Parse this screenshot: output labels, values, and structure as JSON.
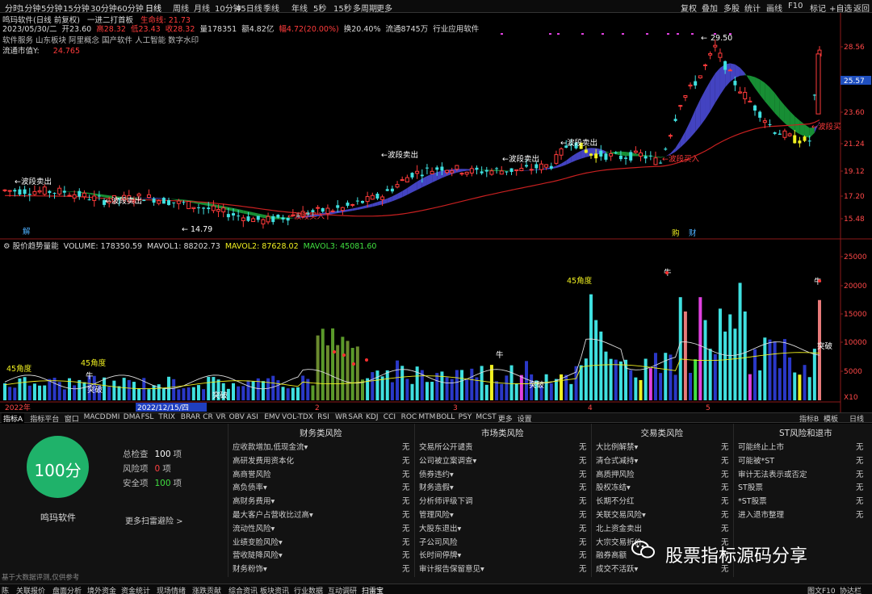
{
  "timeframes": [
    "分时",
    "1分钟",
    "5分钟",
    "15分钟",
    "30分钟",
    "60分钟",
    "日线",
    "周线",
    "月线",
    "10分钟",
    "45日线",
    "季线",
    "年线",
    "5秒",
    "15秒",
    "多周期",
    "更多"
  ],
  "active_timeframe": "日线",
  "right_toolbar": [
    "复权",
    "叠加",
    "多股",
    "统计",
    "画线",
    "F10",
    "标记",
    "+自选",
    "返回"
  ],
  "stock": {
    "title": "鸣玛软件(日线 前复权)",
    "indicator_name": "一进二打首板",
    "life_line_label": "生命线: 21.73",
    "date": "2023/05/30/二",
    "open": "开23.60",
    "high": "高28.32",
    "low": "低23.43",
    "close": "收28.32",
    "volume": "量178351",
    "amount": "额4.82亿",
    "change": "幅4.72(20.00%)",
    "turnover": "换20.40%",
    "float_shares": "流通8745万",
    "industry": "行业应用软件",
    "concepts": "软件服务 山东板块 阿里概念 国产软件 人工智能 数字水印",
    "float_mv_label": "流通市值Y:",
    "float_mv_value": "24.765"
  },
  "price_axis": [
    "28.56",
    "25.57",
    "23.60",
    "21.24",
    "19.12",
    "17.20",
    "15.48"
  ],
  "price_axis_highlight": "25.57",
  "price_annotations": {
    "high_label": "29.50",
    "low_label": "14.79",
    "band_sell_1": "波段卖出",
    "band_sell_2": "波段卖出",
    "band_sell_3": "波段卖出",
    "band_sell_4": "波段卖出",
    "band_sell_5": "波段卖出",
    "band_buy_1": "波段买入",
    "band_buy_2": "波段买入",
    "band_buy_3": "波段买",
    "marker_jie": "解",
    "marker_gou": "购",
    "marker_cai": "财"
  },
  "volume_header": {
    "name": "股价趋势量能",
    "volume": "VOLUME: 178350.59",
    "mavol1": "MAVOL1: 88202.73",
    "mavol2": "MAVOL2: 87628.02",
    "mavol3": "MAVOL3: 45081.60"
  },
  "volume_axis": [
    "25000",
    "20000",
    "15000",
    "10000",
    "5000"
  ],
  "volume_scale_label": "X10",
  "volume_annotations": {
    "angle_1": "45角度",
    "angle_2": "45角度",
    "angle_3": "45角度",
    "niu": "牛",
    "breakthrough": "突破"
  },
  "date_axis": {
    "year": "2022年",
    "cursor_date": "2022/12/15/四",
    "marks": [
      "2",
      "3",
      "4",
      "5"
    ]
  },
  "indicator_tabs": [
    "指标A",
    "指标平台",
    "窗口",
    "MACD",
    "DMI",
    "DMA",
    "FSL",
    "TRIX",
    "BRAR",
    "CR",
    "VR",
    "OBV",
    "ASI",
    "EMV",
    "VOL-TDX",
    "RSI",
    "WR",
    "SAR",
    "KDJ",
    "CCI",
    "ROC",
    "MTM",
    "BOLL",
    "PSY",
    "MCST",
    "更多",
    "设置"
  ],
  "indicator_tabs_right": [
    "指标B",
    "模板",
    "日线"
  ],
  "risk": {
    "score": "100分",
    "stock_name": "鸣玛软件",
    "total_label": "总检查",
    "total_value": "100",
    "total_unit": "项",
    "risk_label": "风险项",
    "risk_value": "0",
    "risk_unit": "项",
    "safe_label": "安全项",
    "safe_value": "100",
    "safe_unit": "项",
    "more_link": "更多扫雷避险 >",
    "disclaimer": "基于大数据评测,仅供参考",
    "columns": [
      {
        "title": "财务类风险",
        "rows": [
          [
            "应收款增加,低现金流▾",
            "无"
          ],
          [
            "高研发费用资本化",
            "无"
          ],
          [
            "高商誉风险",
            "无"
          ],
          [
            "高负债率▾",
            "无"
          ],
          [
            "高财务费用▾",
            "无"
          ],
          [
            "最大客户占营收比过高▾",
            "无"
          ],
          [
            "流动性风险▾",
            "无"
          ],
          [
            "业绩变脸风险▾",
            "无"
          ],
          [
            "营收陡降风险▾",
            "无"
          ],
          [
            "财务粉饰▾",
            "无"
          ]
        ]
      },
      {
        "title": "市场类风险",
        "rows": [
          [
            "交易所公开谴责",
            "无"
          ],
          [
            "公司被立案调查▾",
            "无"
          ],
          [
            "债券违约▾",
            "无"
          ],
          [
            "财务造假▾",
            "无"
          ],
          [
            "分析师评级下调",
            "无"
          ],
          [
            "管理风险▾",
            "无"
          ],
          [
            "大股东退出▾",
            "无"
          ],
          [
            "子公司风险",
            "无"
          ],
          [
            "长时间停牌▾",
            "无"
          ],
          [
            "审计报告保留意见▾",
            "无"
          ]
        ]
      },
      {
        "title": "交易类风险",
        "rows": [
          [
            "大比例解禁▾",
            "无"
          ],
          [
            "清仓式减持▾",
            "无"
          ],
          [
            "高质押风险",
            "无"
          ],
          [
            "股权冻结▾",
            "无"
          ],
          [
            "长期不分红",
            "无"
          ],
          [
            "关联交易风险▾",
            "无"
          ],
          [
            "北上资金卖出",
            "无"
          ],
          [
            "大宗交易折价",
            "无"
          ],
          [
            "融券高额",
            "无"
          ],
          [
            "成交不活跃▾",
            "无"
          ]
        ]
      },
      {
        "title": "ST风险和退市",
        "rows": [
          [
            "可能终止上市",
            "无"
          ],
          [
            "可能被*ST",
            "无"
          ],
          [
            "审计无法表示或否定",
            "无"
          ],
          [
            "ST股票",
            "无"
          ],
          [
            "*ST股票",
            "无"
          ],
          [
            "进入退市整理",
            "无"
          ]
        ]
      }
    ]
  },
  "watermark": "股票指标源码分享",
  "footer_tabs": [
    "陈",
    "关联报价",
    "盘面分析",
    "境外资金",
    "资金统计",
    "现场情绪",
    "涨跌贡献",
    "综合资讯",
    "板块资讯",
    "行业数据",
    "互动调研",
    "扫雷宝"
  ],
  "footer_right": [
    "图文F10",
    "协达栏"
  ],
  "colors": {
    "up": "#ff3b3b",
    "down": "#3fe0e0",
    "price_line": "#c82020",
    "ma_green": "#1a9d3a",
    "ma_blue": "#4a4ad6",
    "magenta": "#e040e0",
    "yellow": "#f0f020",
    "grid": "#8b1a1a"
  }
}
